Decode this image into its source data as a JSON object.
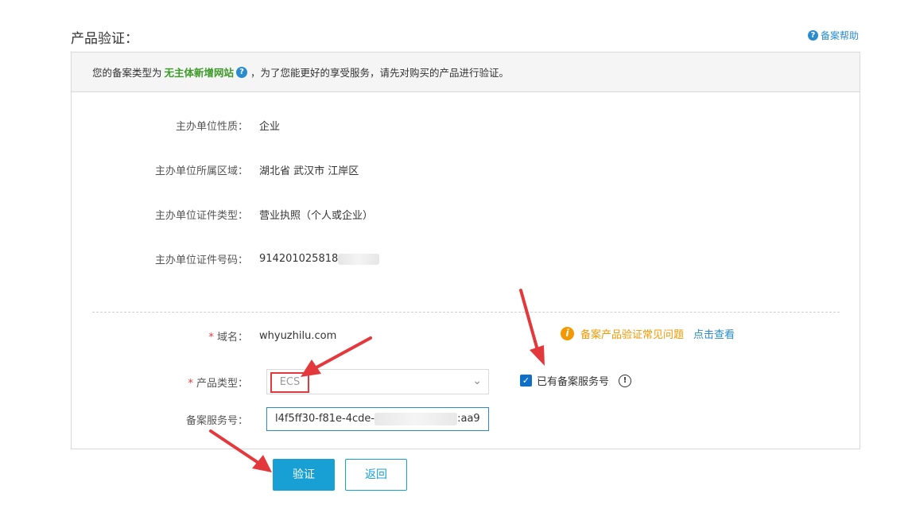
{
  "header": {
    "title": "产品验证：",
    "help_label": "备案帮助"
  },
  "notice": {
    "prefix": "您的备案类型为",
    "highlight": "无主体新增网站",
    "suffix": "，为了您能更好的享受服务，请先对购买的产品进行验证。"
  },
  "info_rows": [
    {
      "label": "主办单位性质：",
      "value": "企业"
    },
    {
      "label": "主办单位所属区域：",
      "value": "湖北省 武汉市 江岸区"
    },
    {
      "label": "主办单位证件类型：",
      "value": "营业执照（个人或企业）"
    },
    {
      "label": "主办单位证件号码：",
      "value": "914201025818"
    }
  ],
  "domain_row": {
    "required_mark": "*",
    "label": "域名：",
    "value": "whyuzhilu.com"
  },
  "faq": {
    "text": "备案产品验证常见问题",
    "link": "点击查看"
  },
  "product_type": {
    "required_mark": "*",
    "label": "产品类型：",
    "value": "ECS"
  },
  "checkbox": {
    "label": "已有备案服务号",
    "checked": true
  },
  "service_no": {
    "label": "备案服务号：",
    "value_start": "l4f5ff30-f81e-4cde-",
    "value_end": ":aa9"
  },
  "buttons": {
    "verify": "验证",
    "back": "返回"
  },
  "colors": {
    "accent": "#18a0d4",
    "link": "#2a8ccf",
    "highlight": "#3c9a28",
    "warning": "#f39800",
    "annotation": "#e4393c"
  }
}
